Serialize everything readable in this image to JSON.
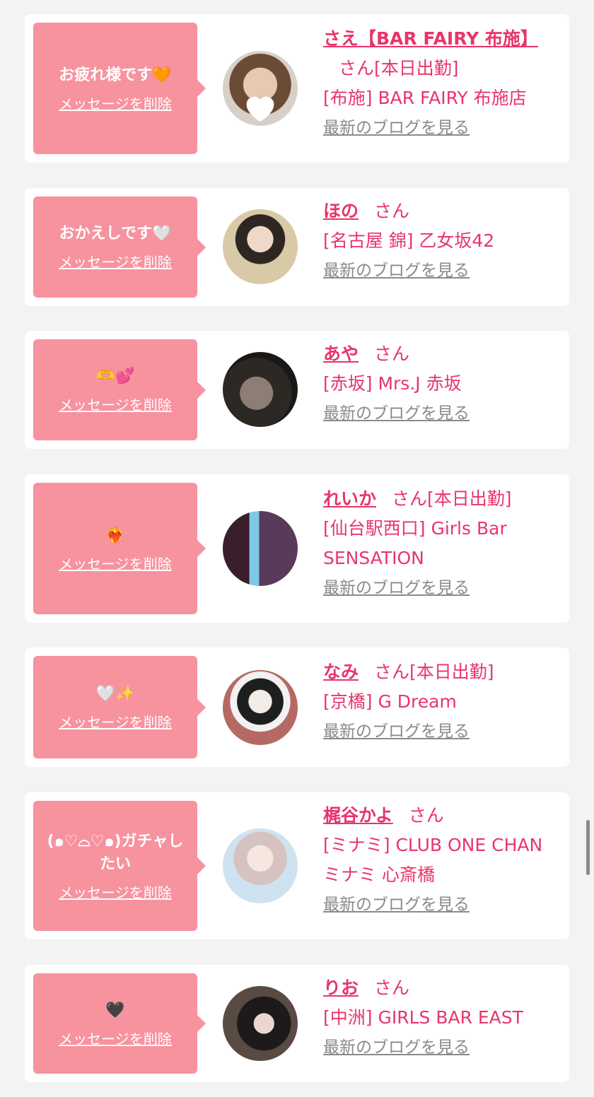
{
  "colors": {
    "accent": "#e8356a",
    "bubble": "#f7929f",
    "background": "#f3f3f3"
  },
  "common": {
    "delete_label": "メッセージを削除",
    "blog_label": "最新のブログを見る",
    "honorific": "さん"
  },
  "items": [
    {
      "message": "お疲れ様です🧡",
      "name": "さえ【BAR FAIRY 布施】",
      "status": "[本日出勤]",
      "shop": "[布施] BAR FAIRY 布施店"
    },
    {
      "message": "おかえしです🤍",
      "name": "ほの",
      "status": "",
      "shop": "[名古屋 錦] 乙女坂42"
    },
    {
      "message": "🫶💕",
      "name": "あや",
      "status": "",
      "shop": "[赤坂] Mrs.J 赤坂"
    },
    {
      "message": "❤️‍🔥",
      "name": "れいか",
      "status": "[本日出勤]",
      "shop": "[仙台駅西口] Girls Bar SENSATION"
    },
    {
      "message": "🤍✨",
      "name": "なみ",
      "status": "[本日出勤]",
      "shop": "[京橋] G Dream"
    },
    {
      "message": "(๑♡⌓♡๑)ガチャしたい",
      "name": "梶谷かよ",
      "status": "",
      "shop": "[ミナミ] CLUB ONE CHAN ミナミ 心斎橋"
    },
    {
      "message": "🖤",
      "name": "りお",
      "status": "",
      "shop": "[中洲] GIRLS BAR EAST"
    }
  ]
}
